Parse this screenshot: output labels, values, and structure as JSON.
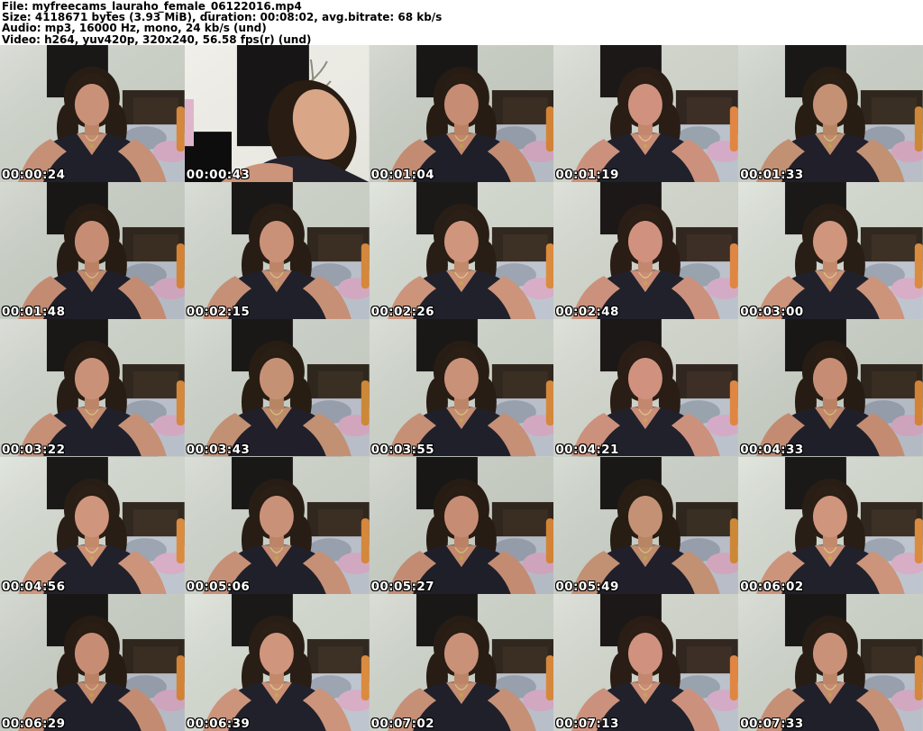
{
  "header": {
    "lines": [
      "File: myfreecams_lauraho_female_06122016.mp4",
      "Size: 4118671 bytes (3.93 MiB), duration: 00:08:02, avg.bitrate: 68 kb/s",
      "Audio: mp3, 16000 Hz, mono, 24 kb/s (und)",
      "Video: h264, yuv420p, 320x240, 56.58 fps(r) (und)"
    ]
  },
  "grid": {
    "columns": 5,
    "rows": 5,
    "thumbnails": [
      {
        "timestamp": "00:00:24",
        "variant": "normal"
      },
      {
        "timestamp": "00:00:43",
        "variant": "closeup"
      },
      {
        "timestamp": "00:01:04",
        "variant": "normal"
      },
      {
        "timestamp": "00:01:19",
        "variant": "normal"
      },
      {
        "timestamp": "00:01:33",
        "variant": "normal"
      },
      {
        "timestamp": "00:01:48",
        "variant": "normal"
      },
      {
        "timestamp": "00:02:15",
        "variant": "normal"
      },
      {
        "timestamp": "00:02:26",
        "variant": "normal"
      },
      {
        "timestamp": "00:02:48",
        "variant": "normal"
      },
      {
        "timestamp": "00:03:00",
        "variant": "normal"
      },
      {
        "timestamp": "00:03:22",
        "variant": "normal"
      },
      {
        "timestamp": "00:03:43",
        "variant": "normal"
      },
      {
        "timestamp": "00:03:55",
        "variant": "normal"
      },
      {
        "timestamp": "00:04:21",
        "variant": "normal"
      },
      {
        "timestamp": "00:04:33",
        "variant": "normal"
      },
      {
        "timestamp": "00:04:56",
        "variant": "normal"
      },
      {
        "timestamp": "00:05:06",
        "variant": "normal"
      },
      {
        "timestamp": "00:05:27",
        "variant": "normal"
      },
      {
        "timestamp": "00:05:49",
        "variant": "normal"
      },
      {
        "timestamp": "00:06:02",
        "variant": "normal"
      },
      {
        "timestamp": "00:06:29",
        "variant": "normal"
      },
      {
        "timestamp": "00:06:39",
        "variant": "normal"
      },
      {
        "timestamp": "00:07:02",
        "variant": "normal"
      },
      {
        "timestamp": "00:07:13",
        "variant": "normal"
      },
      {
        "timestamp": "00:07:33",
        "variant": "normal"
      }
    ]
  },
  "colors": {
    "header_bg": "#ffffff",
    "header_text": "#000000",
    "timestamp_text": "#ffffff",
    "timestamp_outline": "#000000",
    "wall": "#ccd1c8",
    "wardrobe": "#1a1817",
    "headboard": "#30271f",
    "mattress": "#b9bfc9",
    "pillow_gray": "#97a0ac",
    "pillow_pink": "#d2a8c0",
    "pillow_orange": "#d5873c",
    "hair": "#281d14",
    "skin": "#ca9179",
    "top_garment": "#20202a"
  }
}
